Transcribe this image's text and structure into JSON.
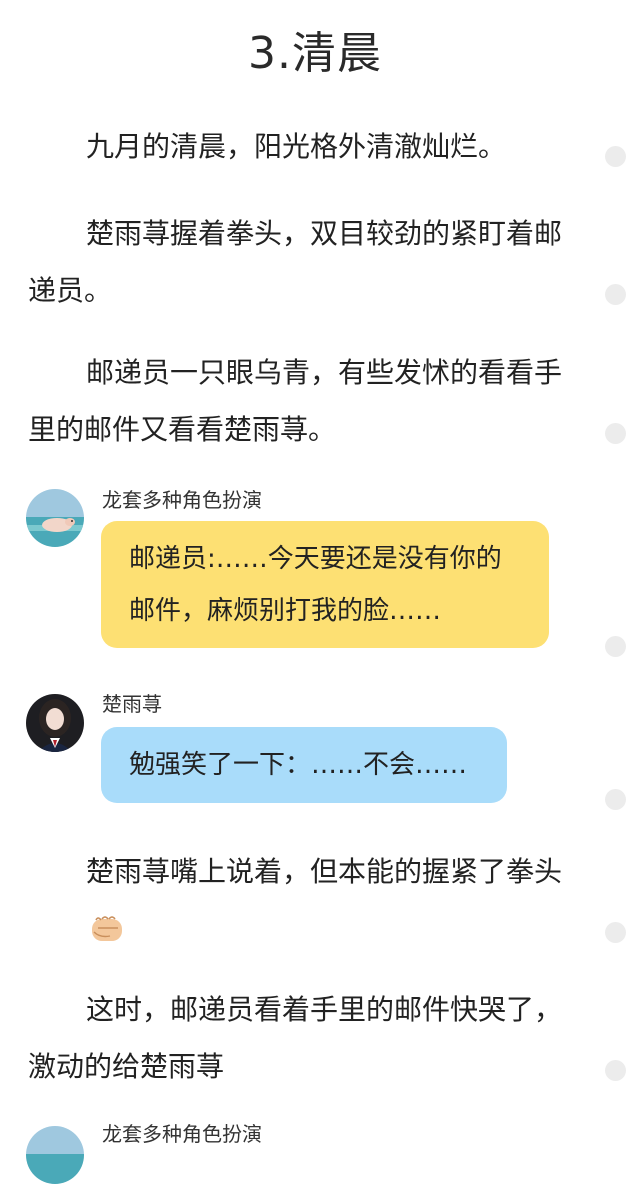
{
  "chapter": {
    "title": "3.清晨"
  },
  "paragraphs": [
    "九月的清晨，阳光格外清澈灿烂。",
    "楚雨荨握着拳头，双目较劲的紧盯着邮递员。",
    "邮递员一只眼乌青，有些发怵的看看手里的邮件又看看楚雨荨。",
    "楚雨荨嘴上说着，但本能的握紧了拳头",
    "这时，邮递员看着手里的邮件快哭了，激动的给楚雨荨"
  ],
  "messages": [
    {
      "sender": "龙套多种角色扮演",
      "text": "邮递员:……今天要还是没有你的邮件，麻烦别打我的脸……",
      "bubble_color": "#fde073",
      "avatar_icon": "pig-at-sea-avatar"
    },
    {
      "sender": "楚雨荨",
      "text": "勉强笑了一下：……不会……",
      "bubble_color": "#a9dcfa",
      "avatar_icon": "girl-portrait-avatar"
    },
    {
      "sender": "龙套多种角色扮演",
      "text": "",
      "bubble_color": "#fde073",
      "avatar_icon": "pig-at-sea-avatar"
    }
  ],
  "icons": {
    "fist_emoji": "fist-icon",
    "side_marker": "comment-dot-icon"
  },
  "colors": {
    "background": "#ffffff",
    "text": "#222222",
    "yellow_bubble": "#fde073",
    "blue_bubble": "#a9dcfa",
    "side_dot": "#ececec"
  }
}
